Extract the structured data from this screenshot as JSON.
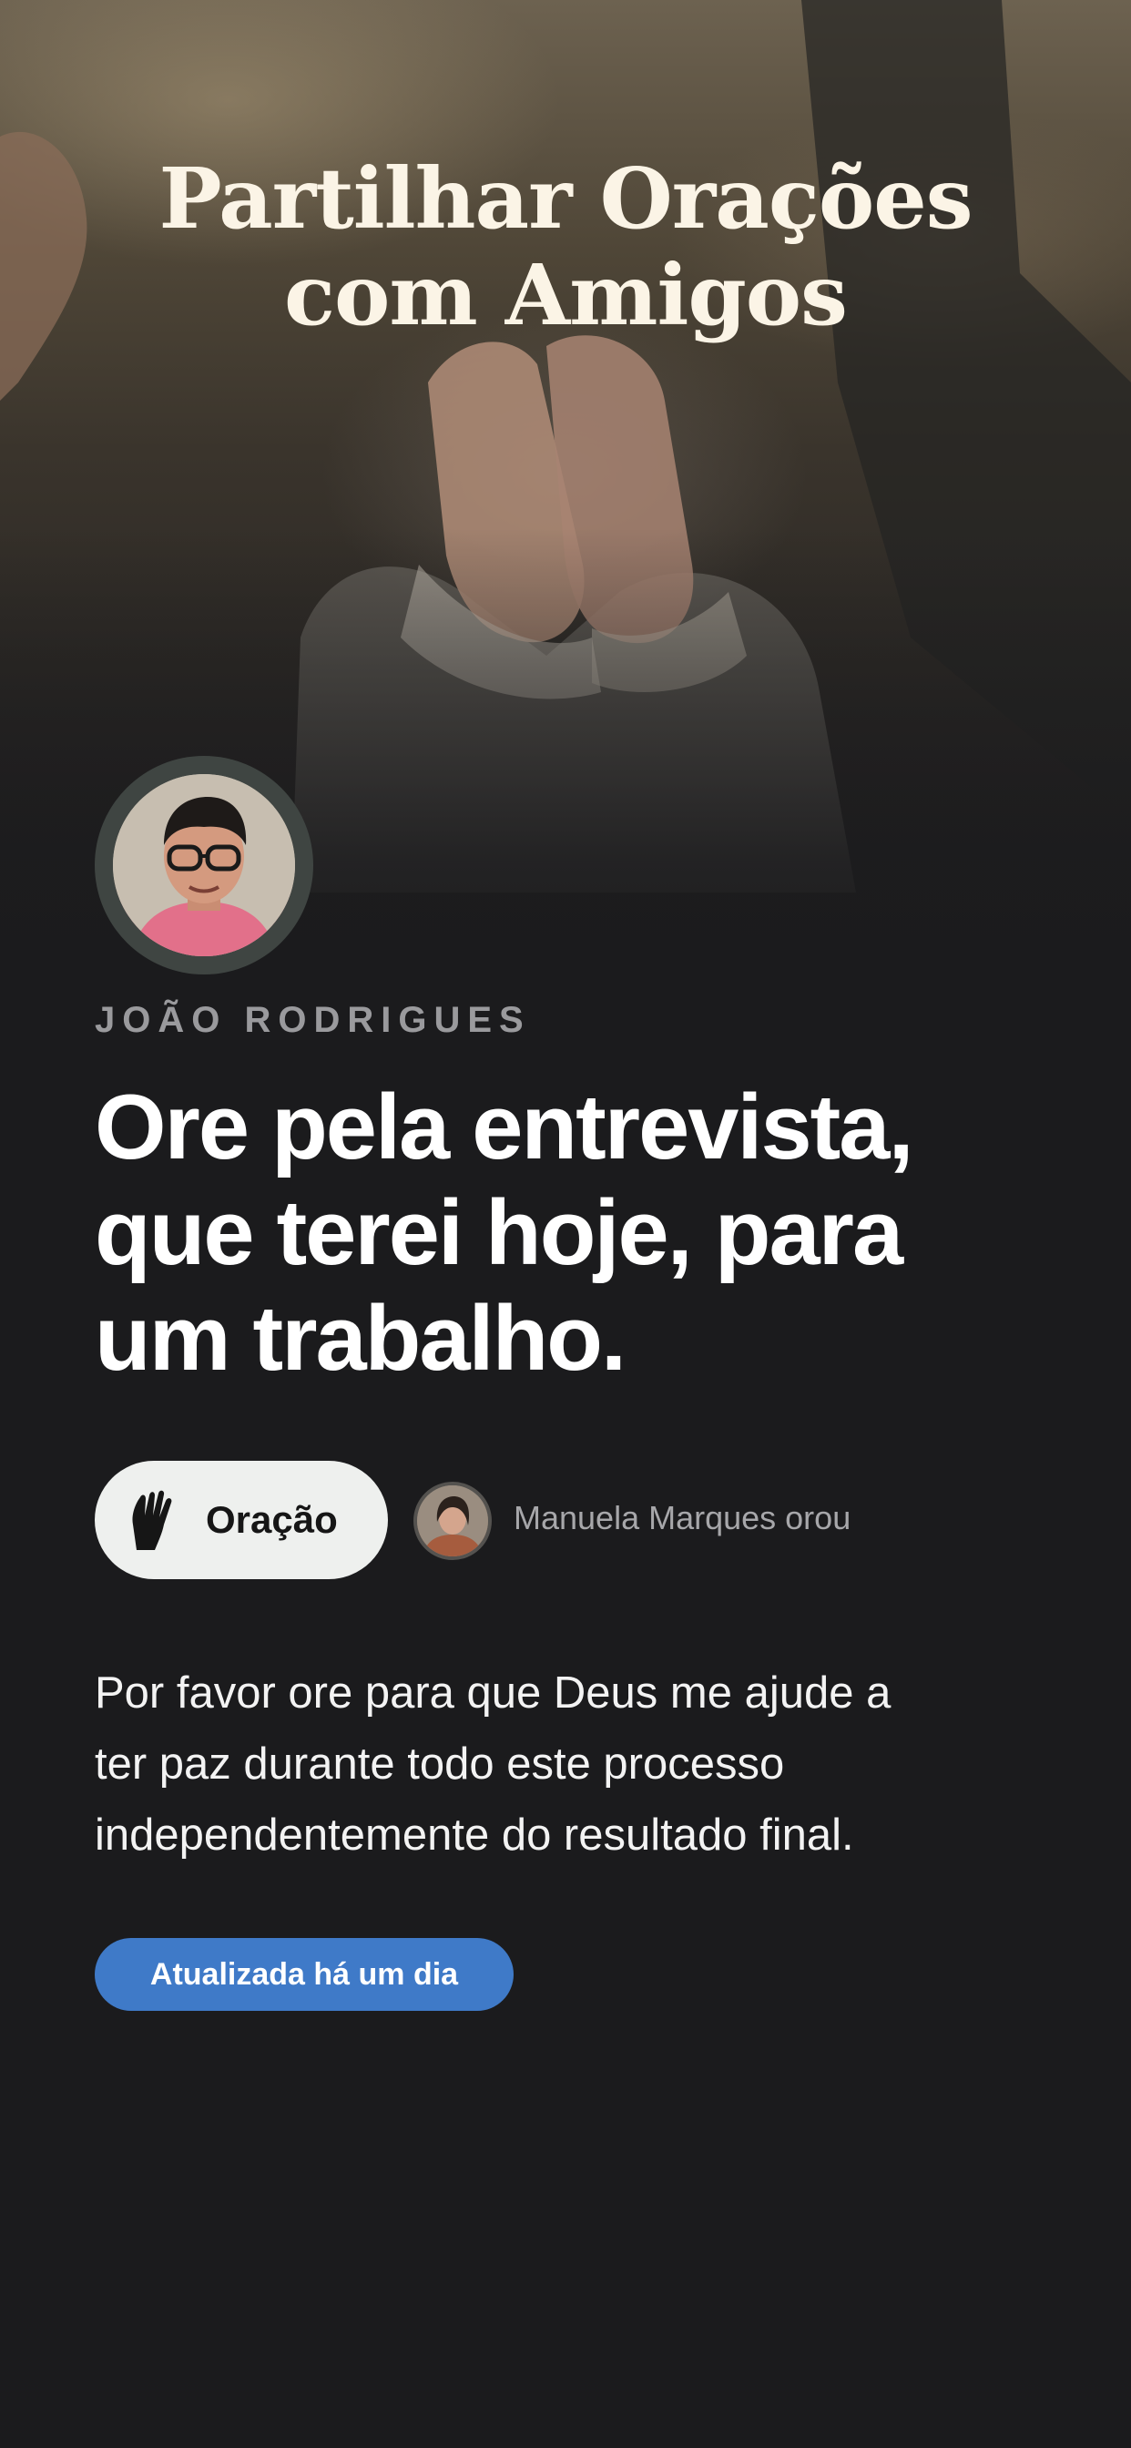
{
  "header": {
    "title_line1": "Partilhar Orações",
    "title_line2": "com Amigos"
  },
  "post": {
    "author_name": "JOÃO RODRIGUES",
    "title_line1": "Ore pela entrevista,",
    "title_line2": "que terei hoje, para",
    "title_line3": "um trabalho.",
    "prayer_button_label": "Oração",
    "prayed_by": "Manuela Marques orou",
    "description_line1": "Por favor ore para que Deus me ajude a",
    "description_line2": "ter paz durante todo este processo",
    "description_line3": "independentemente do resultado final.",
    "updated_label": "Atualizada há um dia"
  },
  "colors": {
    "background": "#1b1b1d",
    "title_cream": "#fbf4e6",
    "badge_blue": "#3f7ac8",
    "button_light": "#eef0ee"
  },
  "icons": {
    "prayer": "praying-hands-icon"
  }
}
